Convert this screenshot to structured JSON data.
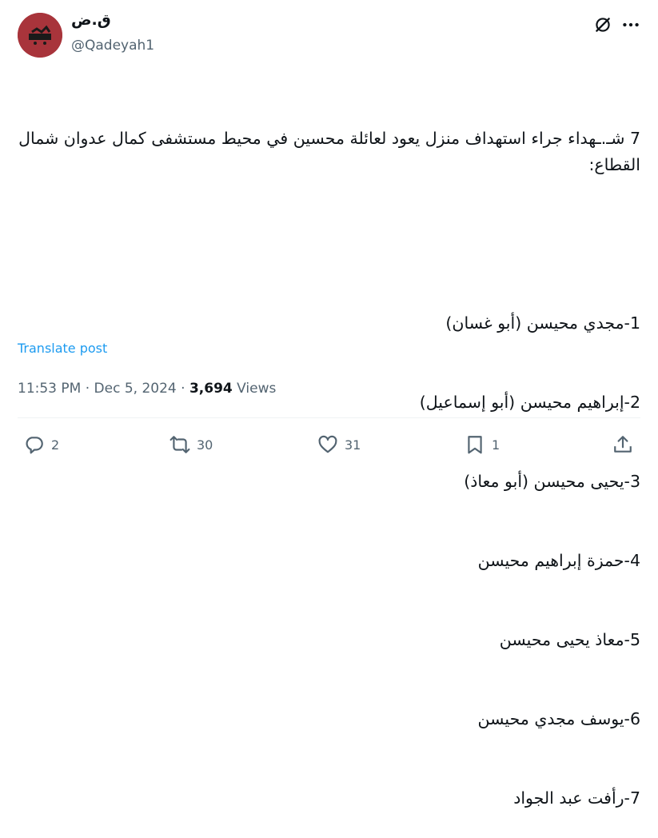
{
  "author": {
    "display_name": "ق.ض",
    "handle": "@Qadeyah1"
  },
  "post": {
    "lines": [
      "7 شـ.ـهداء جراء استهداف منزل يعود لعائلة محسين في محيط مستشفى كمال عدوان شمال القطاع:",
      "",
      "1-مجدي محيسن (أبو غسان)",
      "2-إبراهيم محيسن (أبو إسماعيل)",
      "3-يحيى محيسن (أبو معاذ)",
      "4-حمزة إبراهيم محيسن",
      "5-معاذ يحيى محيسن",
      "6-يوسف مجدي محيسن",
      "7-رأفت عبد الجواد"
    ],
    "translate_label": "Translate post"
  },
  "meta": {
    "time": "11:53 PM",
    "sep1": " · ",
    "date": "Dec 5, 2024",
    "sep2": " · ",
    "views_count": "3,694",
    "views_label": " Views"
  },
  "actions": {
    "replies": "2",
    "reposts": "30",
    "likes": "31",
    "bookmarks": "1"
  },
  "icons": {
    "grok": "grok-icon",
    "more": "more-icon",
    "reply": "reply-icon",
    "repost": "repost-icon",
    "like": "heart-icon",
    "bookmark": "bookmark-icon",
    "share": "share-icon"
  },
  "colors": {
    "link": "#1d9bf0",
    "secondary_text": "#536471",
    "primary_text": "#0f1419",
    "avatar_bg": "#a8343b"
  }
}
